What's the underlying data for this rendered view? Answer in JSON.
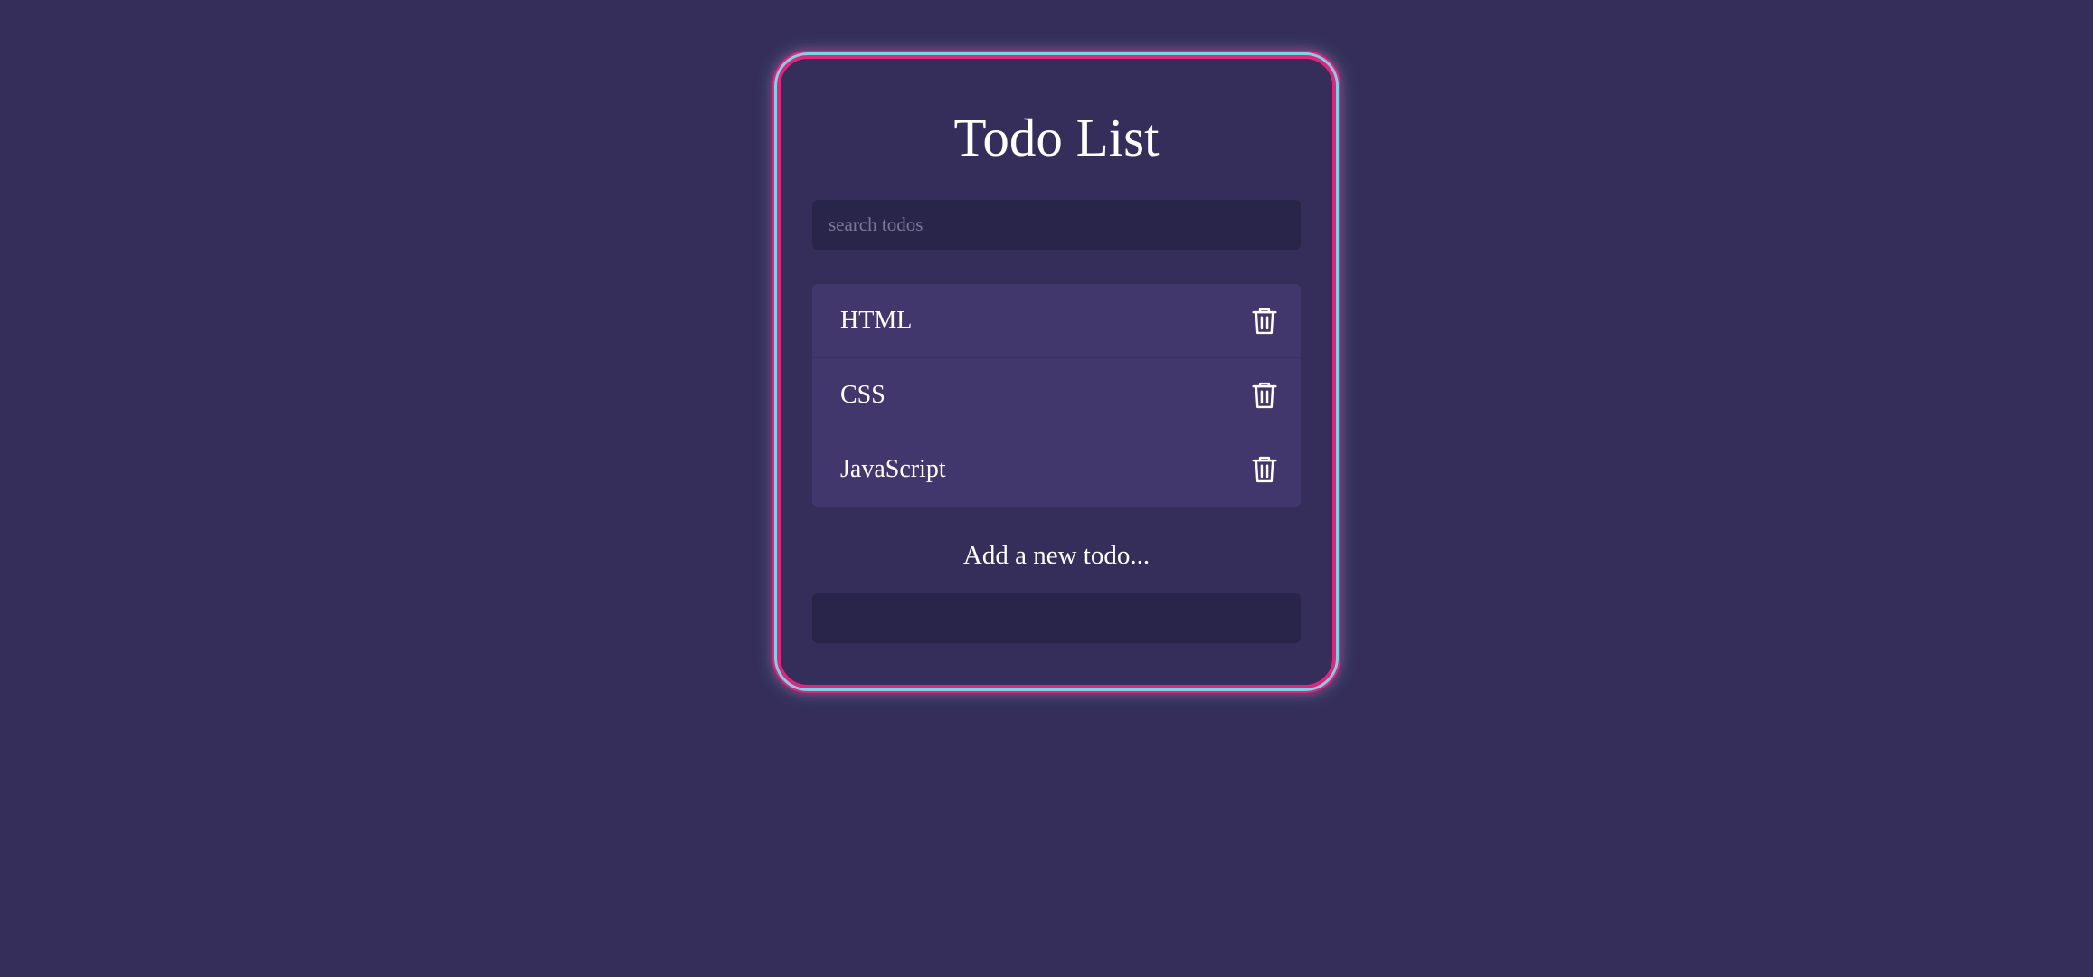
{
  "app": {
    "title": "Todo List"
  },
  "search": {
    "placeholder": "search todos",
    "value": ""
  },
  "todos": [
    {
      "label": "HTML",
      "icon": "trash-icon"
    },
    {
      "label": "CSS",
      "icon": "trash-icon"
    },
    {
      "label": "JavaScript",
      "icon": "trash-icon"
    }
  ],
  "add": {
    "label": "Add a new todo...",
    "value": ""
  },
  "colors": {
    "background": "#352e5a",
    "item_background": "#41376c",
    "input_background": "#29244a",
    "accent_pink": "#e0257f",
    "accent_cyan": "#7bd3e6"
  }
}
